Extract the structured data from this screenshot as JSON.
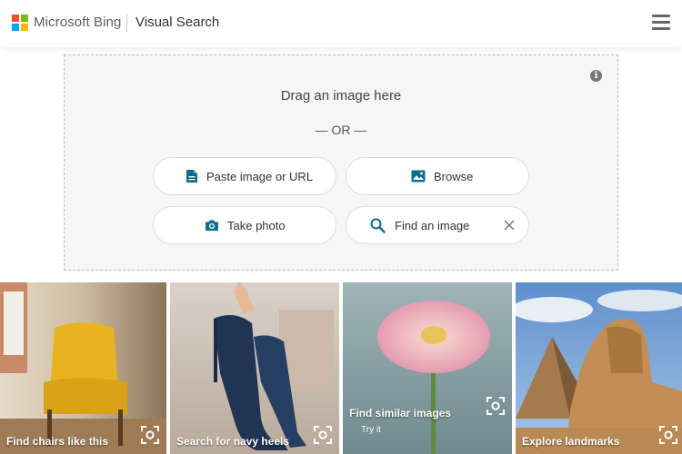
{
  "header": {
    "brand": "Microsoft Bing",
    "section": "Visual Search",
    "logo_colors": [
      "#f25022",
      "#7fba00",
      "#00a4ef",
      "#ffb900"
    ],
    "menu_icon": "hamburger-menu-icon"
  },
  "dropzone": {
    "title": "Drag an image here",
    "or_text": "— OR —",
    "info_icon": "info-icon",
    "buttons": {
      "paste": "Paste image or URL",
      "browse": "Browse",
      "camera": "Take photo",
      "find": "Find an image"
    },
    "accent": "#0f6c8c"
  },
  "tiles": [
    {
      "caption": "Find chairs like this",
      "icon": "visual-search-lens-icon"
    },
    {
      "caption": "Search for navy heels",
      "icon": "visual-search-lens-icon"
    },
    {
      "caption": "Find similar images",
      "sub": "Try it",
      "icon": "visual-search-lens-icon"
    },
    {
      "caption": "Explore landmarks",
      "icon": "visual-search-lens-icon"
    }
  ]
}
